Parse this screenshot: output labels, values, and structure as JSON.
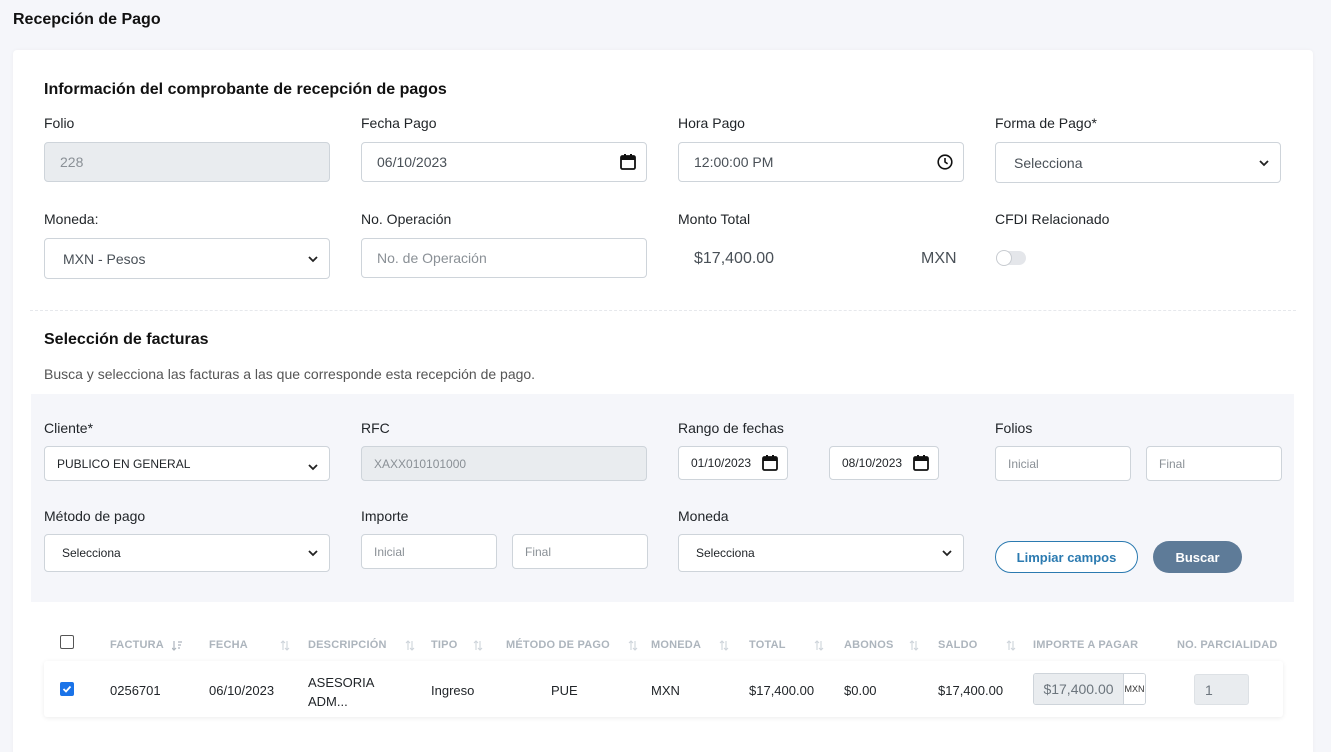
{
  "page": {
    "title": "Recepción de Pago"
  },
  "info": {
    "section_title": "Información del comprobante de recepción de pagos",
    "folio": {
      "label": "Folio",
      "value": "228"
    },
    "fecha_pago": {
      "label": "Fecha Pago",
      "value": "06/10/2023"
    },
    "hora_pago": {
      "label": "Hora Pago",
      "value": "12:00:00 PM"
    },
    "forma_pago": {
      "label": "Forma de Pago*",
      "value": "Selecciona"
    },
    "moneda": {
      "label": "Moneda:",
      "value": "MXN - Pesos"
    },
    "no_operacion": {
      "label": "No. Operación",
      "placeholder": "No. de Operación"
    },
    "monto_total": {
      "label": "Monto Total",
      "value": "$17,400.00",
      "currency": "MXN"
    },
    "cfdi_relacionado": {
      "label": "CFDI Relacionado",
      "enabled": false
    }
  },
  "facturas": {
    "section_title": "Selección de facturas",
    "description": "Busca y selecciona las facturas a las que corresponde esta recepción de pago.",
    "filters": {
      "cliente": {
        "label": "Cliente*",
        "value": "PUBLICO EN GENERAL"
      },
      "rfc": {
        "label": "RFC",
        "value": "XAXX010101000"
      },
      "rango_fechas": {
        "label": "Rango de fechas",
        "start": "01/10/2023",
        "end": "08/10/2023"
      },
      "folios": {
        "label": "Folios",
        "start_placeholder": "Inicial",
        "end_placeholder": "Final"
      },
      "metodo_pago": {
        "label": "Método de pago",
        "value": "Selecciona"
      },
      "importe": {
        "label": "Importe",
        "start_placeholder": "Inicial",
        "end_placeholder": "Final"
      },
      "moneda": {
        "label": "Moneda",
        "value": "Selecciona"
      },
      "clear_label": "Limpiar campos",
      "search_label": "Buscar"
    },
    "table": {
      "headers": [
        "FACTURA",
        "FECHA",
        "DESCRIPCIÓN",
        "TIPO",
        "MÉTODO DE PAGO",
        "MONEDA",
        "TOTAL",
        "ABONOS",
        "SALDO",
        "IMPORTE A PAGAR",
        "NO. PARCIALIDAD"
      ],
      "rows": [
        {
          "selected": true,
          "factura": "0256701",
          "fecha": "06/10/2023",
          "descripcion_1": "ASESORIA",
          "descripcion_2": "ADM...",
          "tipo": "Ingreso",
          "metodo_pago": "PUE",
          "moneda": "MXN",
          "total": "$17,400.00",
          "abonos": "$0.00",
          "saldo": "$17,400.00",
          "importe_pagar": "$17,400.00",
          "importe_moneda": "MXN",
          "no_parcialidad": "1"
        }
      ]
    }
  },
  "colors": {
    "accent": "#2b7ab0",
    "button": "#5e7b98",
    "checkbox": "#1a73e8",
    "panel": "#f5f6fa"
  }
}
